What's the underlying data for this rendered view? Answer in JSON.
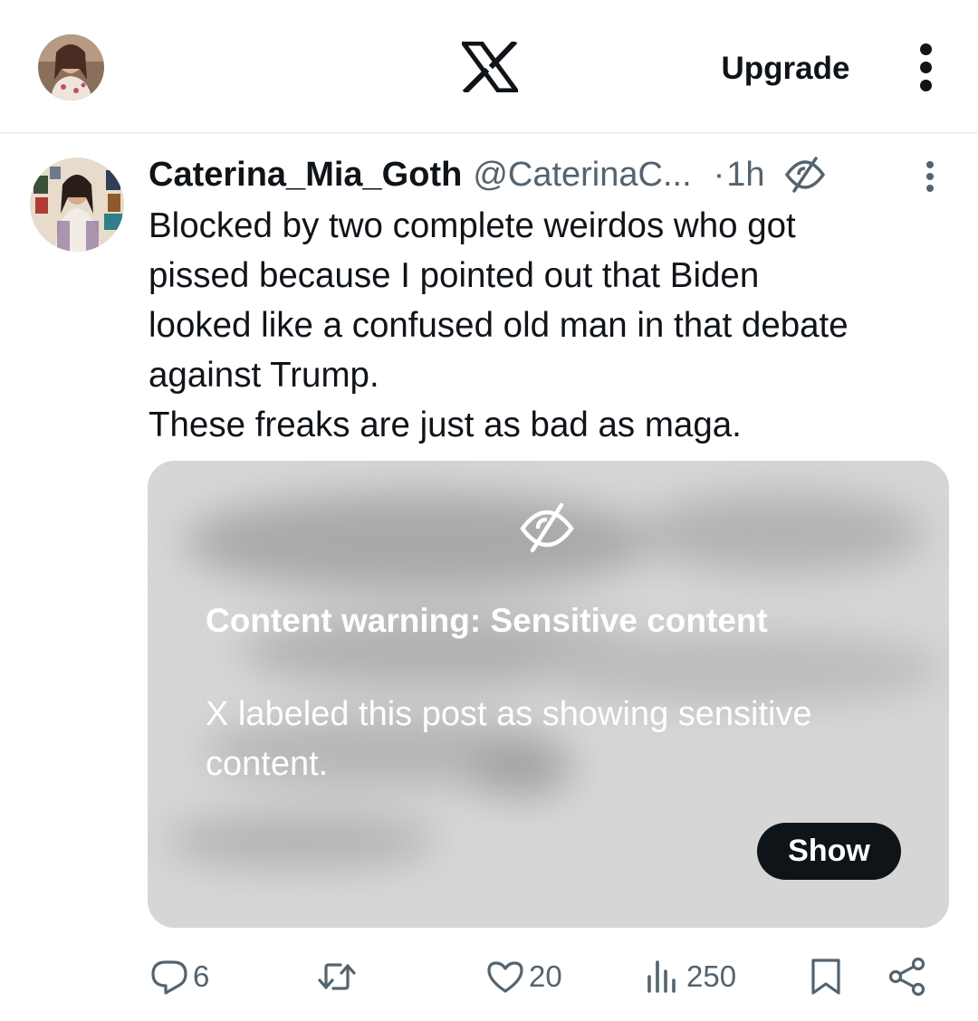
{
  "topbar": {
    "logo_icon": "x-logo-icon",
    "upgrade_label": "Upgrade",
    "more_icon": "more-vertical-icon"
  },
  "post": {
    "author_name": "Caterina_Mia_Goth",
    "author_handle": "@CaterinaC...",
    "separator": "·",
    "time": "1h",
    "label_icon": "eye-off-icon",
    "text_lines": [
      "Blocked by two complete weirdos who got",
      "pissed because I pointed out that Biden",
      "looked like a confused old man in that debate",
      "against Trump.",
      "These freaks are just as bad as maga."
    ],
    "media": {
      "warning_title": "Content warning: Sensitive content",
      "warning_text": "X labeled this post as showing sensitive content.",
      "show_label": "Show"
    },
    "actions": {
      "replies": "6",
      "reposts": "",
      "likes": "20",
      "views": "250"
    }
  },
  "colors": {
    "text": "#0f1419",
    "muted": "#536471",
    "divider": "#eff3f4",
    "media_bg": "#d4d4d4"
  }
}
